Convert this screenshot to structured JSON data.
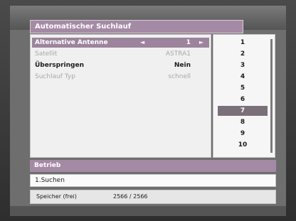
{
  "window": {
    "title": "Automatischer Suchlauf"
  },
  "menu": {
    "rows": [
      {
        "label": "Alternative Antenne",
        "value": "1",
        "arrow_left": "◄",
        "arrow_right": "►"
      },
      {
        "label": "Satellit",
        "value": "ASTRA1"
      },
      {
        "label": "Überspringen",
        "value": "Nein"
      },
      {
        "label": "Suchlauf Typ",
        "value": "schnell"
      }
    ]
  },
  "list": {
    "items": [
      "1",
      "2",
      "3",
      "4",
      "5",
      "6",
      "7",
      "8",
      "9",
      "10"
    ],
    "selected": "7"
  },
  "info": {
    "header": "Betrieb",
    "line": "1.Suchen"
  },
  "footer": {
    "label": "Speicher (frei)",
    "value": "2566 / 2566"
  },
  "colors": {
    "accent": "#a48aa4",
    "selected_item": "#7a707a",
    "panel_bg": "#f0f0f0"
  }
}
